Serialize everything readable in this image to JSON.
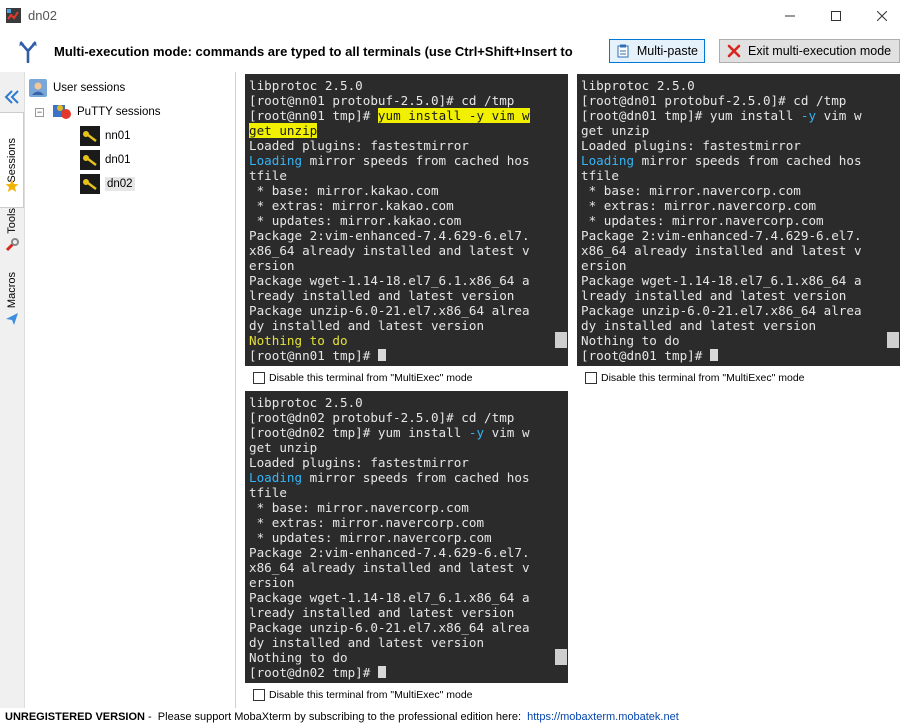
{
  "window": {
    "title": "dn02"
  },
  "multiexec": {
    "message": "Multi-execution mode: commands are typed to all terminals (use Ctrl+Shift+Insert to",
    "multi_paste_label": "Multi-paste",
    "exit_label": "Exit multi-execution mode"
  },
  "sidebar_tabs": {
    "sessions": "Sessions",
    "tools": "Tools",
    "macros": "Macros"
  },
  "tree": {
    "root": "User sessions",
    "folder": "PuTTY sessions",
    "items": [
      "nn01",
      "dn01",
      "dn02"
    ],
    "selected": "dn02"
  },
  "terminals": [
    {
      "name": "nn01",
      "lines": [
        "libprotoc 2.5.0",
        "[root@nn01 protobuf-2.5.0]# cd /tmp",
        "[root@nn01 tmp]# yum install -y vim w",
        "get unzip",
        "Loaded plugins: fastestmirror",
        "Loading mirror speeds from cached hos",
        "tfile",
        " * base: mirror.kakao.com",
        " * extras: mirror.kakao.com",
        " * updates: mirror.kakao.com",
        "Package 2:vim-enhanced-7.4.629-6.el7.",
        "x86_64 already installed and latest v",
        "ersion",
        "Package wget-1.14-18.el7_6.1.x86_64 a",
        "lready installed and latest version",
        "Package unzip-6.0-21.el7.x86_64 alrea",
        "dy installed and latest version",
        "Nothing to do",
        "[root@nn01 tmp]# "
      ],
      "disable_label": "Disable this terminal from \"MultiExec\" mode"
    },
    {
      "name": "dn01",
      "lines": [
        "libprotoc 2.5.0",
        "[root@dn01 protobuf-2.5.0]# cd /tmp",
        "[root@dn01 tmp]# yum install -y vim w",
        "get unzip",
        "Loaded plugins: fastestmirror",
        "Loading mirror speeds from cached hos",
        "tfile",
        " * base: mirror.navercorp.com",
        " * extras: mirror.navercorp.com",
        " * updates: mirror.navercorp.com",
        "Package 2:vim-enhanced-7.4.629-6.el7.",
        "x86_64 already installed and latest v",
        "ersion",
        "Package wget-1.14-18.el7_6.1.x86_64 a",
        "lready installed and latest version",
        "Package unzip-6.0-21.el7.x86_64 alrea",
        "dy installed and latest version",
        "Nothing to do",
        "[root@dn01 tmp]# "
      ],
      "disable_label": "Disable this terminal from \"MultiExec\" mode"
    },
    {
      "name": "dn02",
      "lines": [
        "libprotoc 2.5.0",
        "[root@dn02 protobuf-2.5.0]# cd /tmp",
        "[root@dn02 tmp]# yum install -y vim w",
        "get unzip",
        "Loaded plugins: fastestmirror",
        "Loading mirror speeds from cached hos",
        "tfile",
        " * base: mirror.navercorp.com",
        " * extras: mirror.navercorp.com",
        " * updates: mirror.navercorp.com",
        "Package 2:vim-enhanced-7.4.629-6.el7.",
        "x86_64 already installed and latest v",
        "ersion",
        "Package wget-1.14-18.el7_6.1.x86_64 a",
        "lready installed and latest version",
        "Package unzip-6.0-21.el7.x86_64 alrea",
        "dy installed and latest version",
        "Nothing to do",
        "[root@dn02 tmp]# "
      ],
      "disable_label": "Disable this terminal from \"MultiExec\" mode"
    }
  ],
  "status": {
    "unregistered": "UNREGISTERED VERSION",
    "support_text": " -  Please support MobaXterm by subscribing to the professional edition here:  ",
    "link": "https://mobaxterm.mobatek.net"
  },
  "colors": {
    "terminal_bg": "#2b2b2b",
    "highlight": "#f0f000",
    "keyword_cyan": "#35b4f5",
    "accent_blue": "#0078d7"
  }
}
